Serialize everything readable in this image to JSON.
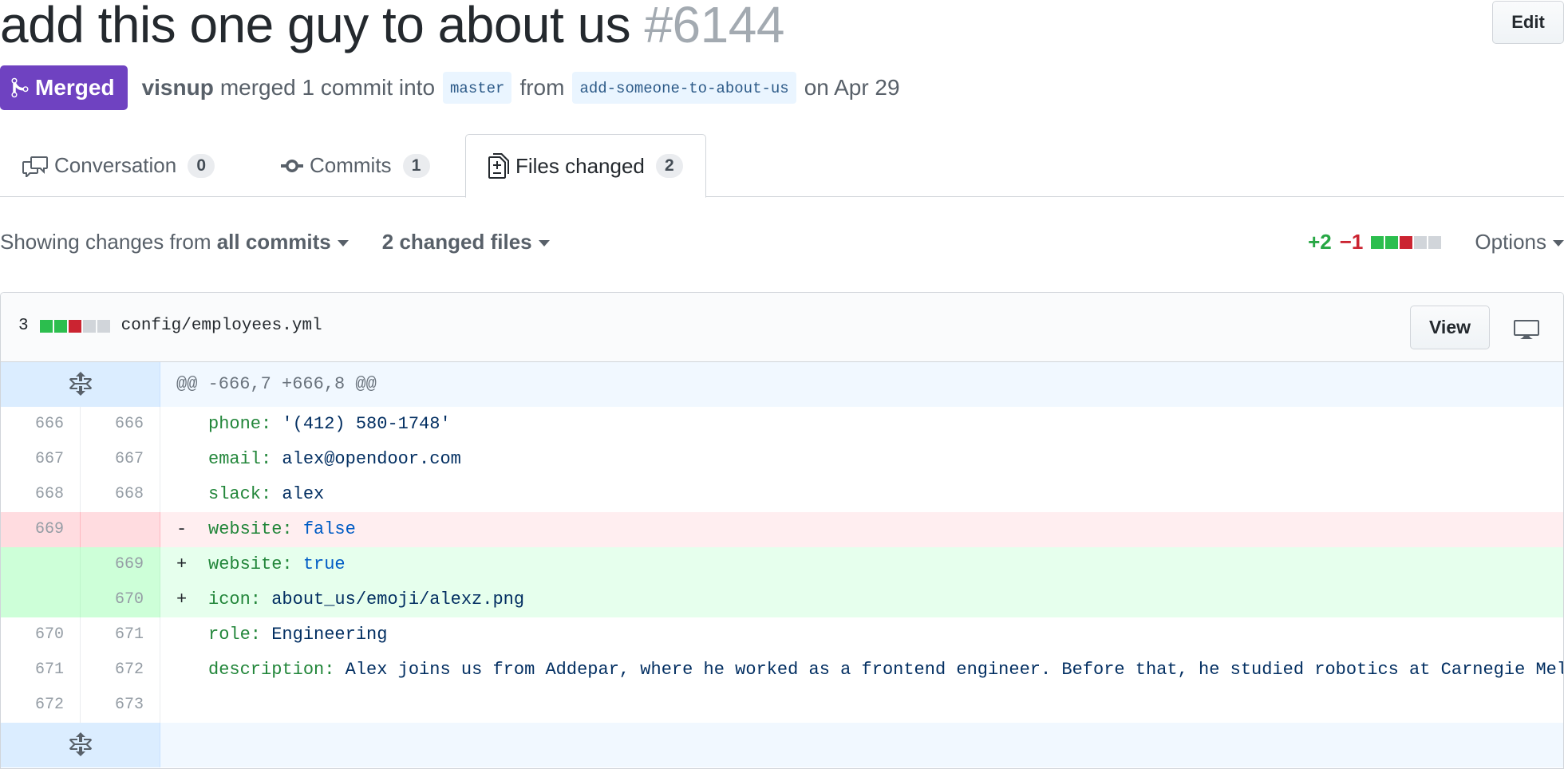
{
  "pr": {
    "title": "add this one guy to about us",
    "number": "#6144",
    "edit_label": "Edit",
    "state": "Merged",
    "author": "visnup",
    "merged_text": "merged 1 commit into",
    "base_branch": "master",
    "from_text": "from",
    "head_branch": "add-someone-to-about-us",
    "date_text": "on Apr 29"
  },
  "tabs": [
    {
      "label": "Conversation",
      "count": "0",
      "icon": "comment-discussion-icon"
    },
    {
      "label": "Commits",
      "count": "1",
      "icon": "git-commit-icon"
    },
    {
      "label": "Files changed",
      "count": "2",
      "icon": "diff-icon",
      "selected": true
    }
  ],
  "toolbar": {
    "showing_prefix": "Showing changes from",
    "commits_filter": "all commits",
    "changed_files": "2 changed files",
    "additions": "+2",
    "deletions": "−1",
    "options_label": "Options"
  },
  "file": {
    "changes": "3",
    "path": "config/employees.yml",
    "view_label": "View",
    "hunk_header": "@@ -666,7 +666,8 @@",
    "lines": [
      {
        "type": "ctx",
        "old": "666",
        "new": "666",
        "marker": " ",
        "key": "phone:",
        "value": "'(412) 580-1748'",
        "value_class": "str"
      },
      {
        "type": "ctx",
        "old": "667",
        "new": "667",
        "marker": " ",
        "key": "email:",
        "value": "alex@opendoor.com",
        "value_class": "str"
      },
      {
        "type": "ctx",
        "old": "668",
        "new": "668",
        "marker": " ",
        "key": "slack:",
        "value": "alex",
        "value_class": "str"
      },
      {
        "type": "del",
        "old": "669",
        "new": "",
        "marker": "-",
        "key": "website:",
        "value": "false",
        "value_class": "val"
      },
      {
        "type": "add",
        "old": "",
        "new": "669",
        "marker": "+",
        "key": "website:",
        "value": "true",
        "value_class": "val"
      },
      {
        "type": "add",
        "old": "",
        "new": "670",
        "marker": "+",
        "key": "icon:",
        "value": "about_us/emoji/alexz.png",
        "value_class": "str"
      },
      {
        "type": "ctx",
        "old": "670",
        "new": "671",
        "marker": " ",
        "key": "role:",
        "value": "Engineering",
        "value_class": "str"
      },
      {
        "type": "ctx",
        "old": "671",
        "new": "672",
        "marker": " ",
        "key": "description:",
        "value": "Alex joins us from Addepar, where he worked as a frontend engineer. Before that, he studied robotics at Carnegie Mel",
        "value_class": "str"
      },
      {
        "type": "ctx",
        "old": "672",
        "new": "673",
        "marker": " ",
        "key": "",
        "value": "",
        "value_class": "str"
      }
    ]
  },
  "colors": {
    "merged": "#6f42c1",
    "addition": "#28a745",
    "deletion": "#cb2431"
  }
}
